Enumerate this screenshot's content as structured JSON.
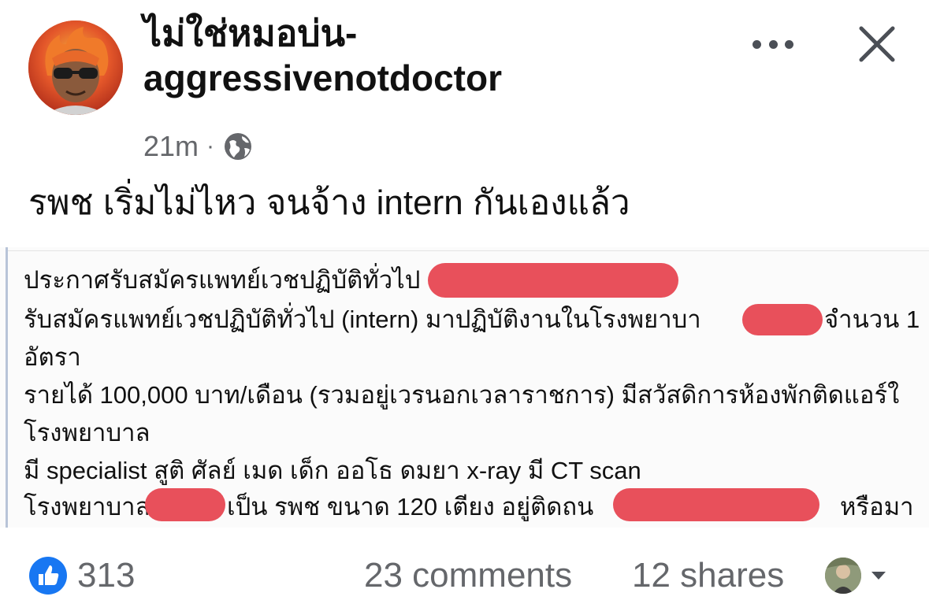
{
  "post": {
    "author": "ไม่ใช่หมอบ่น-\naggressivenotdoctor",
    "time": "21m",
    "separator": "·",
    "privacy_icon": "globe-icon",
    "caption": "รพช เริ่มไม่ไหว จนจ้าง intern กันเองแล้ว"
  },
  "header": {
    "more_icon": "more-dots-icon",
    "close_icon": "close-icon"
  },
  "image_text": {
    "line1": "ประกาศรับสมัครแพทย์เวชปฏิบัติทั่วไป",
    "line2a": "รับสมัครแพทย์เวชปฏิบัติทั่วไป  (intern) มาปฏิบัติงานในโรงพยาบา",
    "line2b": "จำนวน 1",
    "line3": "อัตรา",
    "line4": "รายได้ 100,000 บาท/เดือน (รวมอยู่เวรนอกเวลาราชการ) มีสวัสดิการห้องพักติดแอร์ใ",
    "line5": "โรงพยาบาล",
    "line6": "มี specialist สูติ  ศัลย์ เมด เด็ก ออโธ ดมยา x-ray มี CT scan",
    "line7a": "โรงพยาบาล",
    "line7b": "เป็น รพช ขนาด 120 เตียง อยู่ติดถน",
    "line7c": "หรือมา"
  },
  "footer": {
    "like_count": "313",
    "comments": "23 comments",
    "shares": "12 shares",
    "like_icon": "thumbs-up-icon",
    "reaction_selector_icon": "chevron-down-icon"
  },
  "colors": {
    "accent_blue": "#1877f2",
    "redaction": "#e8505b",
    "secondary_text": "#65676b"
  }
}
